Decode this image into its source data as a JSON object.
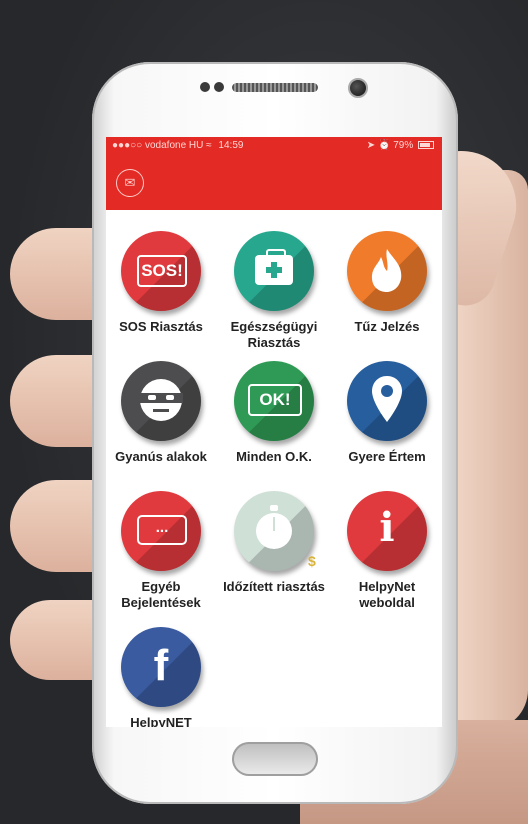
{
  "status_bar": {
    "carrier": "●●●○○ vodafone HU",
    "time": "14:59",
    "battery": "79%"
  },
  "tiles": [
    {
      "label": "SOS Riasztás",
      "icon_text": "SOS!",
      "color": "#e03a3e"
    },
    {
      "label": "Egészségügyi Riasztás",
      "color": "#27a88e"
    },
    {
      "label": "Tűz Jelzés",
      "color": "#f07b2a"
    },
    {
      "label": "Gyanús alakok",
      "color": "#4d4d4f"
    },
    {
      "label": "Minden O.K.",
      "icon_text": "OK!",
      "color": "#2f9a55"
    },
    {
      "label": "Gyere Értem",
      "color": "#275e9e"
    },
    {
      "label": "Egyéb Bejelentések",
      "icon_text": "...",
      "color": "#e03a3e"
    },
    {
      "label": "Időzített riasztás",
      "color": "#cfe0d7"
    },
    {
      "label": "HelpyNet weboldal",
      "icon_text": "i",
      "color": "#e03a3e"
    },
    {
      "label": "HelpyNET",
      "icon_text": "f",
      "color": "#3a5ba0"
    }
  ]
}
